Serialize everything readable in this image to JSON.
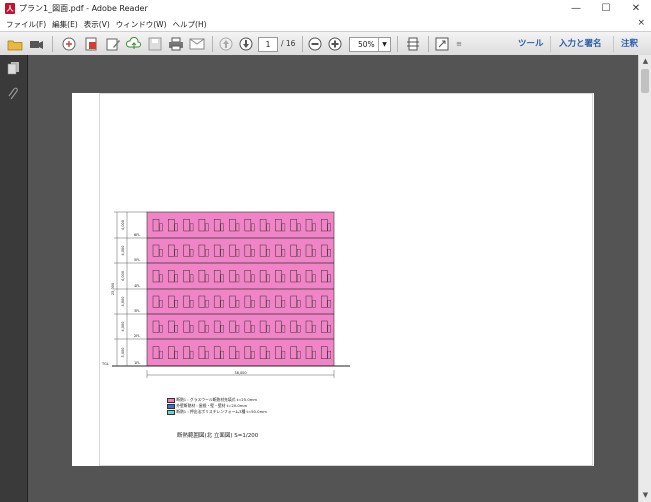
{
  "window": {
    "title": "プラン1_図面.pdf - Adobe Reader",
    "icon": "adobe-reader-icon",
    "buttons": {
      "minimize": "—",
      "maximize": "☐",
      "close": "✕"
    }
  },
  "menu": {
    "items": [
      "ファイル(F)",
      "編集(E)",
      "表示(V)",
      "ウィンドウ(W)",
      "ヘルプ(H)"
    ],
    "close_glyph": "×"
  },
  "toolbar": {
    "page_current": "1",
    "page_total": "/ 16",
    "zoom": "50%",
    "right_links": [
      "ツール",
      "入力と署名",
      "注釈"
    ]
  },
  "drawing": {
    "floor_labels": [
      "6FL",
      "5FL",
      "4FL",
      "3FL",
      "2FL",
      "1FL"
    ],
    "ground_label": "TGL",
    "floor_heights": [
      "4,000",
      "4,000",
      "4,000",
      "4,000",
      "4,000",
      "5,000"
    ],
    "total_height": "25,000",
    "total_width": "38,000",
    "legend": [
      {
        "color": "#ef7fbf",
        "text": "断熱1 : グラスウール断熱材充填式 t=25.0mm"
      },
      {
        "color": "#3f6fd8",
        "text": "外壁断熱材 : 屋根・壁・壁材 t=20.0mm"
      },
      {
        "color": "#6fd6c8",
        "text": "断熱1 : 押出法ポリスチレンフォーム3種 t=50.0mm"
      }
    ],
    "caption": "断熱範囲図(北 立面図)  S=1/200"
  },
  "colors": {
    "facade_pink": "#f084c6",
    "doc_bg": "#545454",
    "link_blue": "#2a5da8"
  }
}
